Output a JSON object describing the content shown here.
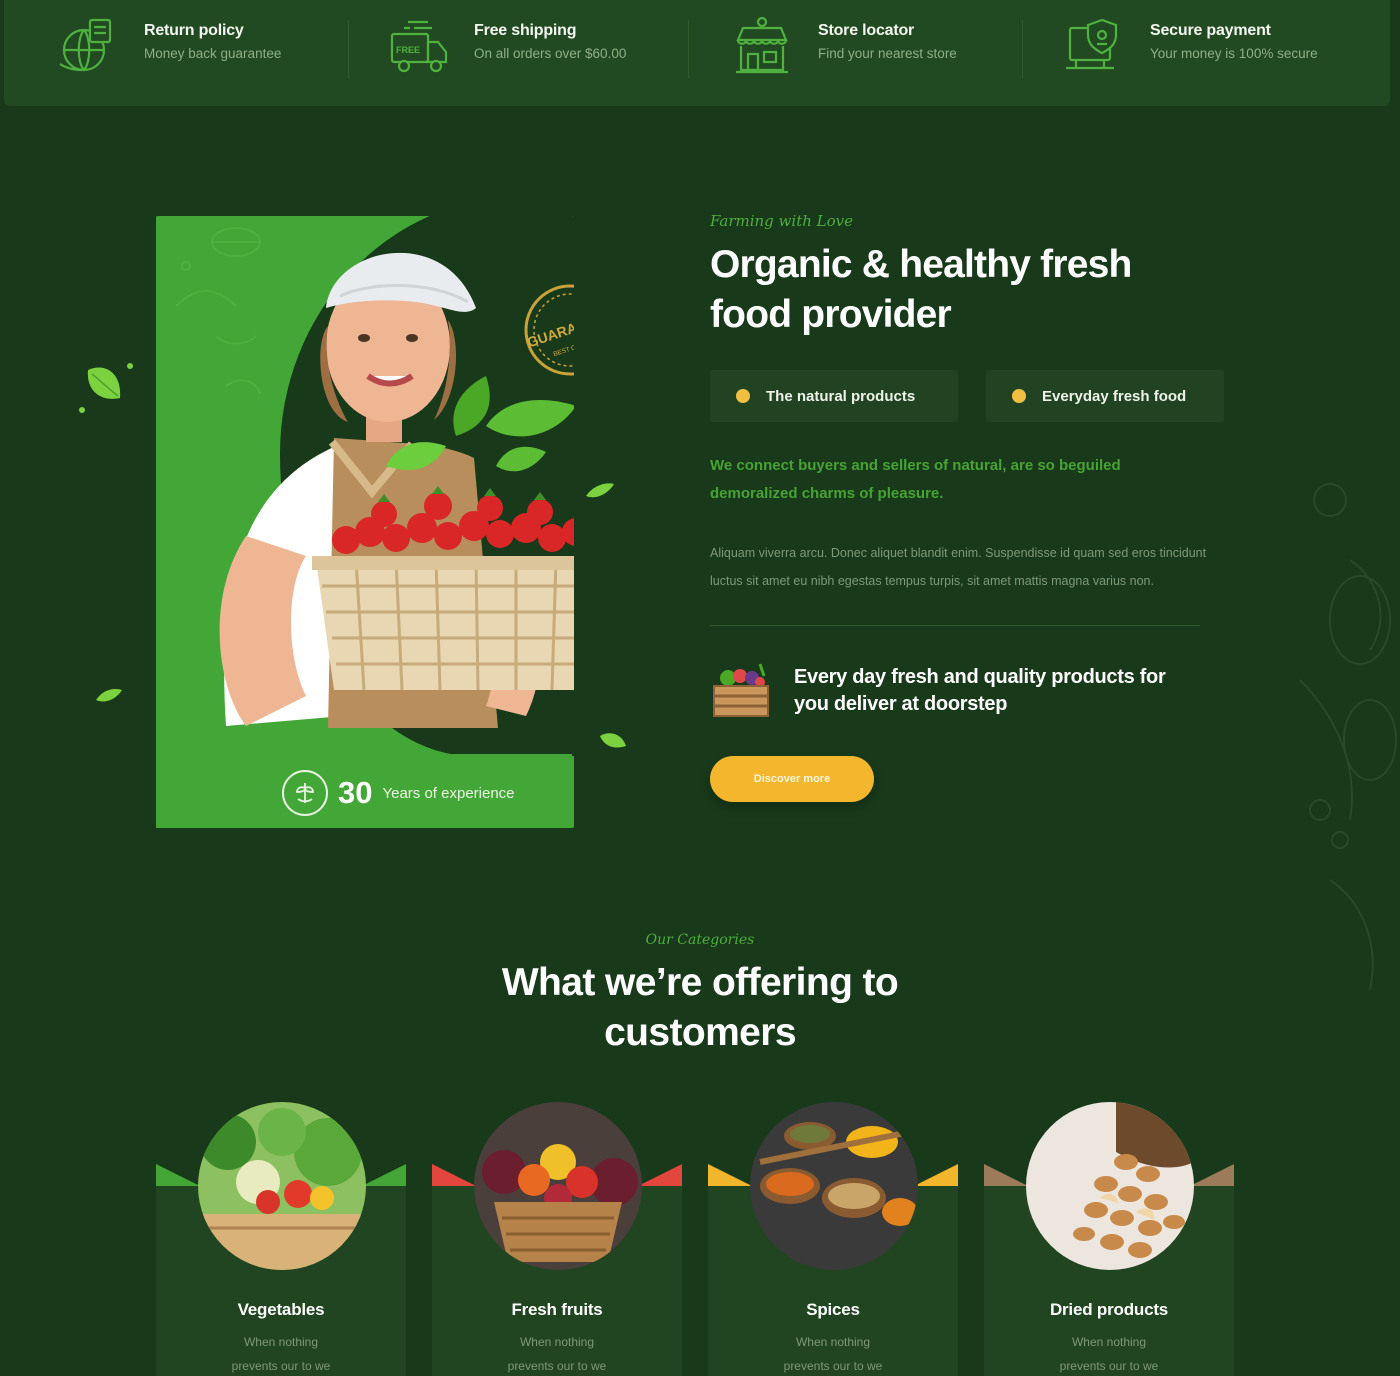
{
  "features": [
    {
      "title": "Return policy",
      "subtitle": "Money back guarantee",
      "icon": "globe-return-icon"
    },
    {
      "title": "Free shipping",
      "subtitle": "On all orders over $60.00",
      "icon": "truck-icon"
    },
    {
      "title": "Store locator",
      "subtitle": "Find your nearest store",
      "icon": "store-icon"
    },
    {
      "title": "Secure payment",
      "subtitle": "Your money is 100% secure",
      "icon": "secure-payment-icon"
    }
  ],
  "about": {
    "eyebrow": "Farming with Love",
    "title": "Organic & healthy fresh food provider",
    "pills": [
      "The natural products",
      "Everyday fresh food"
    ],
    "lead": "We connect buyers and sellers of natural, are so beguiled demoralized charms of pleasure.",
    "body": "Aliquam viverra arcu. Donec aliquet blandit enim. Suspendisse id quam sed eros tincidunt luctus sit amet eu nibh egestas tempus turpis, sit amet mattis magna varius non.",
    "promise": "Every day fresh and quality products for you deliver at doorstep",
    "cta": "Discover more",
    "years_number": "30",
    "years_label": "Years of experience",
    "stamp_text": "GUARANTEE",
    "stamp_sub": "BEST QUALITY"
  },
  "categories": {
    "eyebrow": "Our Categories",
    "title": "What we’re offering to customers",
    "items": [
      {
        "name": "Vegetables",
        "desc": "When nothing prevents our to we like best be",
        "accent": "#43a636"
      },
      {
        "name": "Fresh fruits",
        "desc": "When nothing prevents our to we like best be",
        "accent": "#e2463c"
      },
      {
        "name": "Spices",
        "desc": "When nothing prevents our to we like best be",
        "accent": "#f1b62b"
      },
      {
        "name": "Dried products",
        "desc": "When nothing prevents our to we like best be",
        "accent": "#9b7b5a"
      }
    ]
  },
  "colors": {
    "background": "#18391a",
    "brand_green": "#42a736",
    "accent_yellow": "#f3b62c"
  }
}
